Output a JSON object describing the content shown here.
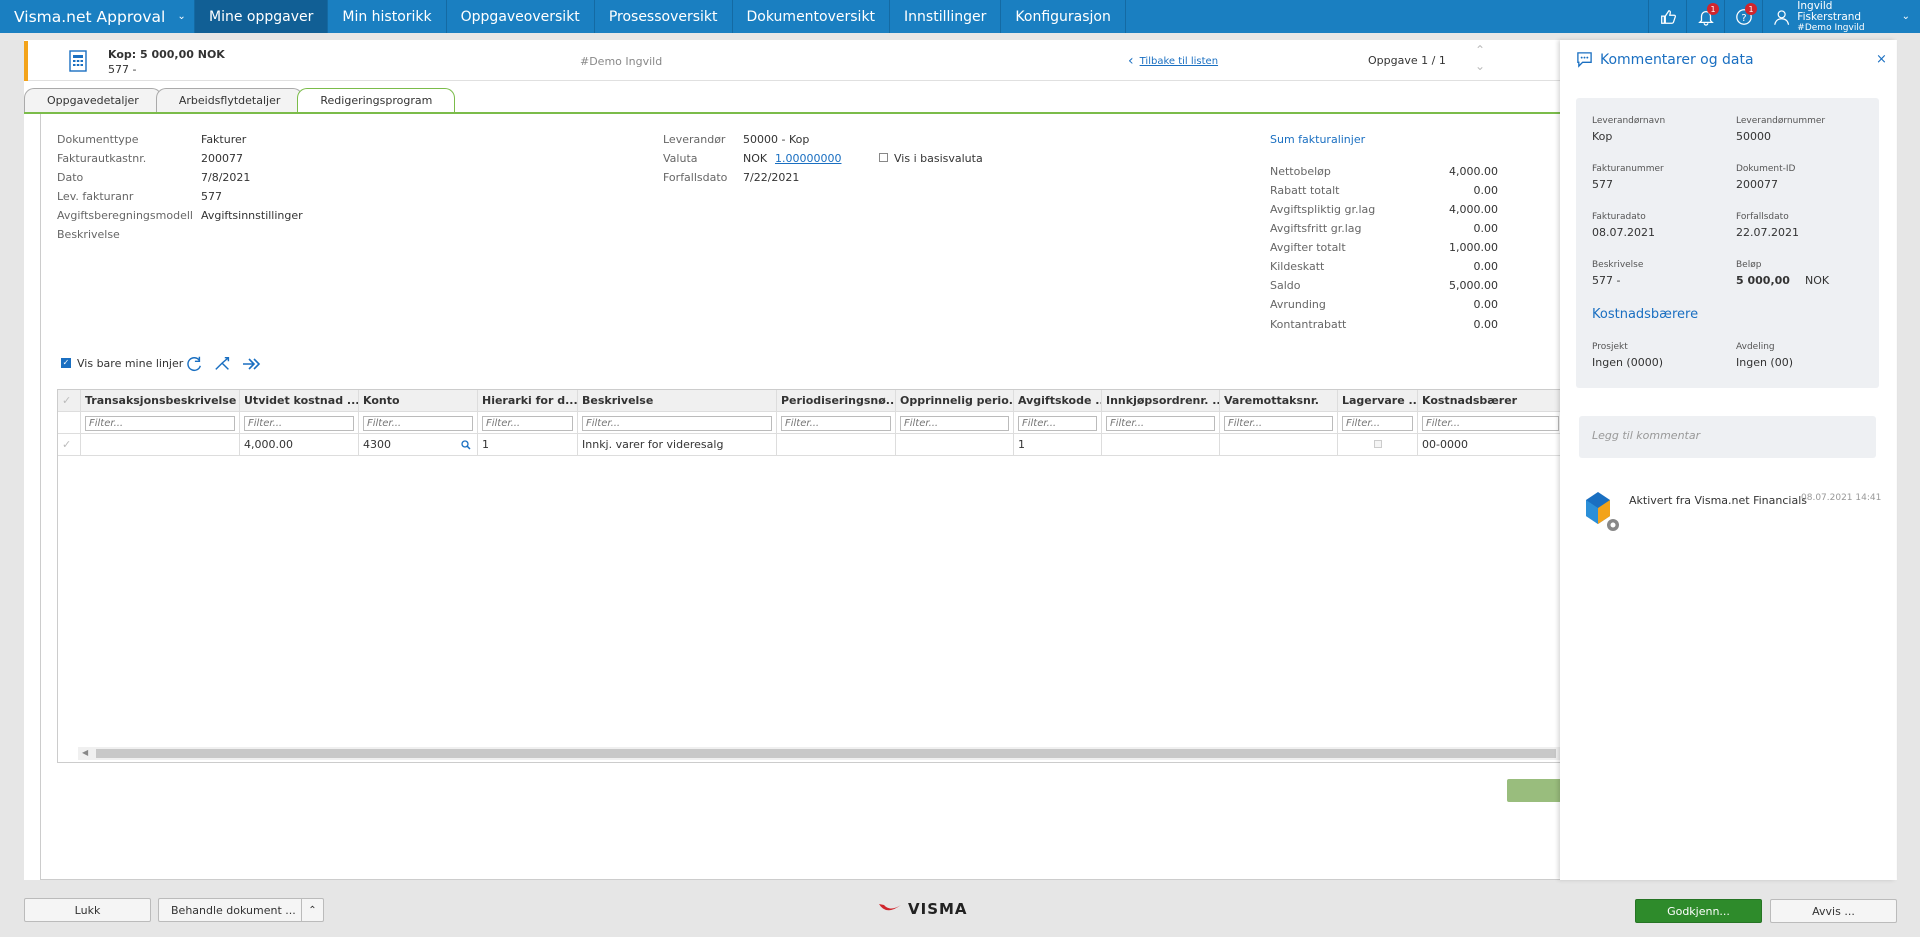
{
  "nav": {
    "brand": "Visma.net Approval",
    "tabs": [
      "Mine oppgaver",
      "Min historikk",
      "Oppgaveoversikt",
      "Prosessoversikt",
      "Dokumentoversikt",
      "Innstillinger",
      "Konfigurasjon"
    ],
    "badge_bell": "1",
    "badge_help": "1",
    "user_name": "Ingvild Fiskerstrand",
    "user_company": "#Demo Ingvild"
  },
  "header": {
    "title": "Kop: 5 000,00 NOK",
    "subtitle": "577 -",
    "company": "#Demo Ingvild",
    "back_link": "Tilbake til listen",
    "task_counter": "Oppgave 1 / 1"
  },
  "tabs": [
    "Oppgavedetaljer",
    "Arbeidsflytdetaljer",
    "Redigeringsprogram"
  ],
  "doc": {
    "left": [
      {
        "label": "Dokumenttype",
        "value": "Fakturer"
      },
      {
        "label": "Fakturautkastnr.",
        "value": "200077"
      },
      {
        "label": "Dato",
        "value": "7/8/2021"
      },
      {
        "label": "Lev. fakturanr",
        "value": "577"
      },
      {
        "label": "Avgiftsberegningsmodell",
        "value": "Avgiftsinnstillinger"
      },
      {
        "label": "Beskrivelse",
        "value": ""
      }
    ],
    "supplier_label": "Leverandør",
    "supplier_value": "50000 - Kop",
    "currency_label": "Valuta",
    "currency_value": "NOK",
    "currency_rate": "1.00000000",
    "basis_currency_label": "Vis i basisvaluta",
    "due_label": "Forfallsdato",
    "due_value": "7/22/2021"
  },
  "sums": {
    "title": "Sum fakturalinjer",
    "rows": [
      {
        "label": "Nettobeløp",
        "value": "4,000.00"
      },
      {
        "label": "Rabatt totalt",
        "value": "0.00"
      },
      {
        "label": "Avgiftspliktig gr.lag",
        "value": "4,000.00"
      },
      {
        "label": "Avgiftsfritt gr.lag",
        "value": "0.00"
      },
      {
        "label": "Avgifter totalt",
        "value": "1,000.00"
      },
      {
        "label": "Kildeskatt",
        "value": "0.00"
      },
      {
        "label": "Saldo",
        "value": "5,000.00"
      },
      {
        "label": "Avrunding",
        "value": "0.00"
      },
      {
        "label": "Kontantrabatt",
        "value": "0.00"
      }
    ]
  },
  "grid": {
    "only_mine_label": "Vis bare mine linjer",
    "filter_placeholder": "Filter...",
    "columns": [
      "Transaksjonsbeskrivelse ...",
      "Utvidet kostnad ...",
      "Konto",
      "Hierarki for d...",
      "Beskrivelse",
      "Periodiseringsnø...",
      "Opprinnelig perio...",
      "Avgiftskode ...",
      "Innkjøpsordrenr. ...",
      "Varemottaksnr.",
      "Lagervare ...",
      "Kostnadsbærer"
    ],
    "rows": [
      [
        "",
        "4,000.00",
        "4300",
        "1",
        "Innkj. varer for videresalg",
        "",
        "",
        "1",
        "",
        "",
        "",
        "00-0000"
      ]
    ]
  },
  "panel": {
    "title": "Kommentarer og data",
    "fields": [
      {
        "label": "Leverandørnavn",
        "value": "Kop"
      },
      {
        "label": "Leverandørnummer",
        "value": "50000"
      },
      {
        "label": "Fakturanummer",
        "value": "577"
      },
      {
        "label": "Dokument-ID",
        "value": "200077"
      },
      {
        "label": "Fakturadato",
        "value": "08.07.2021"
      },
      {
        "label": "Forfallsdato",
        "value": "22.07.2021"
      },
      {
        "label": "Beskrivelse",
        "value": "577 -"
      },
      {
        "label": "Beløp",
        "value": "5 000,00"
      }
    ],
    "amount_currency": "NOK",
    "cost_heading": "Kostnadsbærere",
    "cost_fields": [
      {
        "label": "Prosjekt",
        "value": "Ingen (0000)"
      },
      {
        "label": "Avdeling",
        "value": "Ingen (00)"
      }
    ],
    "comment_placeholder": "Legg til kommentar",
    "activity_text": "Aktivert fra Visma.net Financials",
    "activity_time": "08.07.2021 14:41"
  },
  "footer": {
    "close": "Lukk",
    "handle": "Behandle dokument ...",
    "logo": "VISMA",
    "approve": "Godkjenn...",
    "reject": "Avvis ..."
  },
  "colors": {
    "nav": "#1a7fc1",
    "accent": "#f3a31a",
    "approve": "#2e8b2b",
    "tab_green": "#7bbc4a"
  }
}
